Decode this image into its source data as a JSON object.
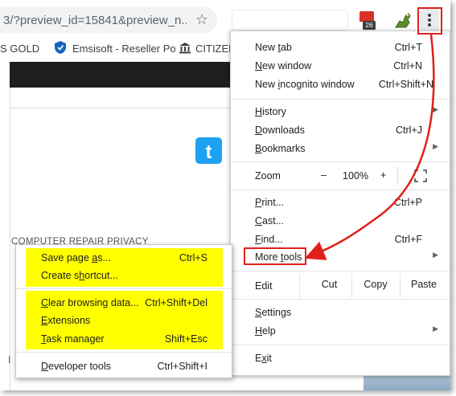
{
  "toolbar": {
    "url": "3/?preview_id=15841&preview_n...",
    "calendar_badge": "26"
  },
  "bookmarks": {
    "item1": "S GOLD",
    "item2": "Emsisoft - Reseller Po",
    "item3": "CITIZEN"
  },
  "page": {
    "nav_text": "COMPUTER REPAIR         PRIVACY",
    "bottom_letter": "I"
  },
  "main_menu": {
    "new_tab": "New tab",
    "new_tab_sc": "Ctrl+T",
    "new_window": "New window",
    "new_window_sc": "Ctrl+N",
    "new_incognito": "New incognito window",
    "new_incognito_sc": "Ctrl+Shift+N",
    "history": "History",
    "downloads": "Downloads",
    "downloads_sc": "Ctrl+J",
    "bookmarks": "Bookmarks",
    "zoom_label": "Zoom",
    "zoom_minus": "–",
    "zoom_value": "100%",
    "zoom_plus": "+",
    "print": "Print...",
    "print_sc": "Ctrl+P",
    "cast": "Cast...",
    "find": "Find...",
    "find_sc": "Ctrl+F",
    "more_tools": "More tools",
    "edit_label": "Edit",
    "cut": "Cut",
    "copy": "Copy",
    "paste": "Paste",
    "settings": "Settings",
    "help": "Help",
    "exit": "Exit"
  },
  "sub_menu": {
    "save_page": "Save page as...",
    "save_page_sc": "Ctrl+S",
    "create_shortcut": "Create shortcut...",
    "clear_browsing": "Clear browsing data...",
    "clear_browsing_sc": "Ctrl+Shift+Del",
    "extensions": "Extensions",
    "task_manager": "Task manager",
    "task_manager_sc": "Shift+Esc",
    "developer_tools": "Developer tools",
    "developer_tools_sc": "Ctrl+Shift+I"
  },
  "colors": {
    "highlight": "#ffff00",
    "annotation": "#e0201a",
    "twitter": "#1da1f2"
  }
}
